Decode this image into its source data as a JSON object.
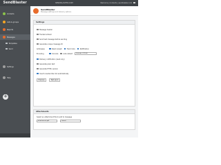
{
  "topbar": {
    "brand": "SendBlaster",
    "center_text": "SENDBLASTER.COM",
    "right_text": "Welcome | Contacts | sendblaster.com"
  },
  "sidebar": {
    "items": [
      {
        "label": "Contacts",
        "color": "#8bc34a"
      },
      {
        "label": "Lists & groups",
        "color": "#f6a623"
      },
      {
        "label": "Reports",
        "color": "#e86c2c"
      },
      {
        "label": "Messages",
        "color": "#e86c2c"
      },
      {
        "label": "Templates"
      },
      {
        "label": "Send"
      },
      {
        "label": "Settings",
        "color": "#9e9e9e"
      },
      {
        "label": "Help",
        "color": "#9e9e9e"
      }
    ],
    "add_label": "+"
  },
  "header": {
    "title": "SendBlaster",
    "subtitle": "Message settings and delivery options"
  },
  "settings_panel": {
    "title": "Settings",
    "rows": [
      {
        "label": "Message header",
        "checked": false
      },
      {
        "label": "Tracked embed",
        "checked": false
      },
      {
        "label": "Send test message before sending",
        "checked": false
      },
      {
        "label": "Generate unique message ID",
        "checked": false
      }
    ],
    "option_row_1": {
      "label": "Addresses",
      "a": "Read receipt",
      "b": "Track links",
      "c": "Notification"
    },
    "option_row_2": {
      "label": "Encoding",
      "a": "Unicode",
      "b": "Auto-detect",
      "select": "Unicode (UTF-8)"
    },
    "extra_rows": [
      {
        "label": "Delivery notification (read only)",
        "checked": true
      },
      {
        "label": "Generate plain text",
        "checked": false
      },
      {
        "label": "Generate HTML version",
        "checked": false
      },
      {
        "label": "Insert unsubscribe link automatically",
        "checked": true
      }
    ],
    "buttons": {
      "preview": "Preview",
      "test": "Test send"
    }
  },
  "bottom_panel": {
    "title": "Attachments",
    "row_label": "Select an attachment file to add to message",
    "select": "attachment.pdf",
    "select2": "(none)"
  }
}
